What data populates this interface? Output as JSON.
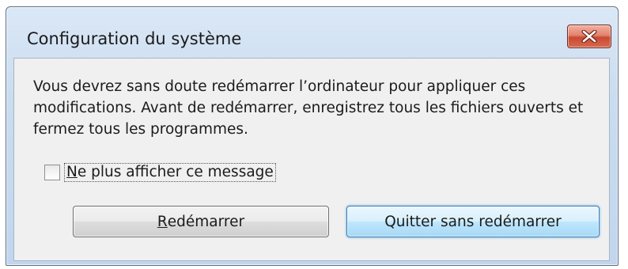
{
  "window": {
    "title": "Configuration du système"
  },
  "dialog": {
    "message": "Vous devrez sans doute redémarrer l’ordinateur pour appliquer ces modifications. Avant de redémarrer, enregistrez tous les fichiers ouverts et fermez tous les programmes.",
    "checkbox": {
      "label_accel": "N",
      "label_rest": "e plus afficher ce message",
      "checked": false
    },
    "buttons": {
      "restart_accel": "R",
      "restart_rest": "edémarrer",
      "quit_label": "Quitter sans redémarrer"
    }
  },
  "colors": {
    "frame": "#c4d7ee",
    "close_button": "#c74a31",
    "default_button_glow": "#3c7fb1",
    "content_bg": "#f0f0f0"
  },
  "icons": {
    "close": "close-icon"
  }
}
